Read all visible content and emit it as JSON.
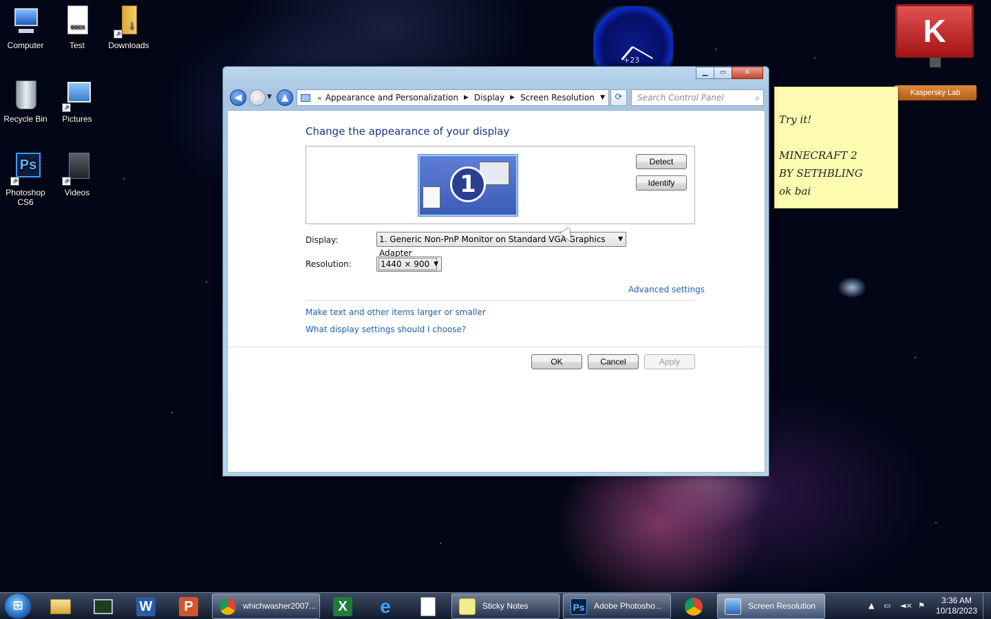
{
  "desktop": {
    "icons": [
      {
        "label": "Computer",
        "icon": "computer-icon"
      },
      {
        "label": "Test",
        "icon": "docx-file-icon",
        "badge": "DOCX"
      },
      {
        "label": "Downloads",
        "icon": "downloads-folder-icon"
      },
      {
        "label": "Recycle Bin",
        "icon": "recycle-bin-icon"
      },
      {
        "label": "Pictures",
        "icon": "pictures-icon"
      },
      {
        "label": "Photoshop CS6",
        "icon": "photoshop-icon",
        "badge": "Ps"
      },
      {
        "label": "Videos",
        "icon": "videos-icon"
      }
    ]
  },
  "gadgets": {
    "clock_text": "+23",
    "kaspersky_label": "Kaspersky Lab",
    "kaspersky_logo": "K",
    "sticky_lines": [
      "Try it!",
      "",
      "MINECRAFT 2",
      "BY SETHBLING",
      "ok bai"
    ]
  },
  "window": {
    "breadcrumb": [
      "Appearance and Personalization",
      "Display",
      "Screen Resolution"
    ],
    "search_placeholder": "Search Control Panel",
    "heading": "Change the appearance of your display",
    "monitor_number": "1",
    "detect_label": "Detect",
    "identify_label": "Identify",
    "display_label": "Display:",
    "display_value": "1. Generic Non-PnP Monitor on Standard VGA Graphics Adapter",
    "resolution_label": "Resolution:",
    "resolution_value": "1440 × 900",
    "advanced_link": "Advanced settings",
    "links": [
      "Make text and other items larger or smaller",
      "What display settings should I choose?"
    ],
    "ok_label": "OK",
    "cancel_label": "Cancel",
    "apply_label": "Apply"
  },
  "taskbar": {
    "pinned": [
      "explorer-icon",
      "task-manager-icon",
      "word-icon",
      "powerpoint-icon"
    ],
    "buttons": [
      {
        "label": "whichwasher2007...",
        "icon": "chrome-icon"
      },
      {
        "label": "Sticky Notes",
        "icon": "sticky-notes-icon"
      },
      {
        "label": "Adobe Photosho...",
        "icon": "photoshop-icon",
        "badge": "Ps"
      },
      {
        "label": "Screen Resolution",
        "icon": "display-icon"
      }
    ],
    "time": "3:36 AM",
    "date": "10/18/2023"
  },
  "colors": {
    "link": "#1e5fb3",
    "heading": "#1e3287",
    "sticky": "#fdfbb0"
  }
}
